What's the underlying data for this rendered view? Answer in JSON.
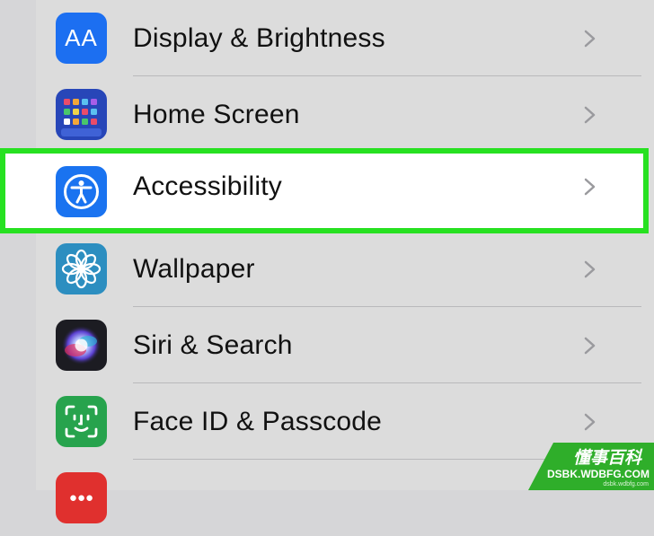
{
  "settings": {
    "items": [
      {
        "label": "Display & Brightness",
        "icon": "display-brightness-icon",
        "color": "#1c6ff1"
      },
      {
        "label": "Home Screen",
        "icon": "home-screen-icon",
        "color": "#2746b8"
      },
      {
        "label": "Accessibility",
        "icon": "accessibility-icon",
        "color": "#1a73f0",
        "highlighted": true
      },
      {
        "label": "Wallpaper",
        "icon": "wallpaper-icon",
        "color": "#2c8ec0"
      },
      {
        "label": "Siri & Search",
        "icon": "siri-icon",
        "color": "#1c1c22"
      },
      {
        "label": "Face ID & Passcode",
        "icon": "face-id-icon",
        "color": "#27a34d"
      },
      {
        "label": "",
        "icon": "emergency-sos-icon",
        "color": "#e0302e"
      }
    ]
  },
  "display_icon_text": "AA",
  "highlight_color": "#27e121",
  "watermark": {
    "title": "懂事百科",
    "url": "DSBK.WDBFG.COM",
    "small": "dsbk.wdbfg.com"
  }
}
